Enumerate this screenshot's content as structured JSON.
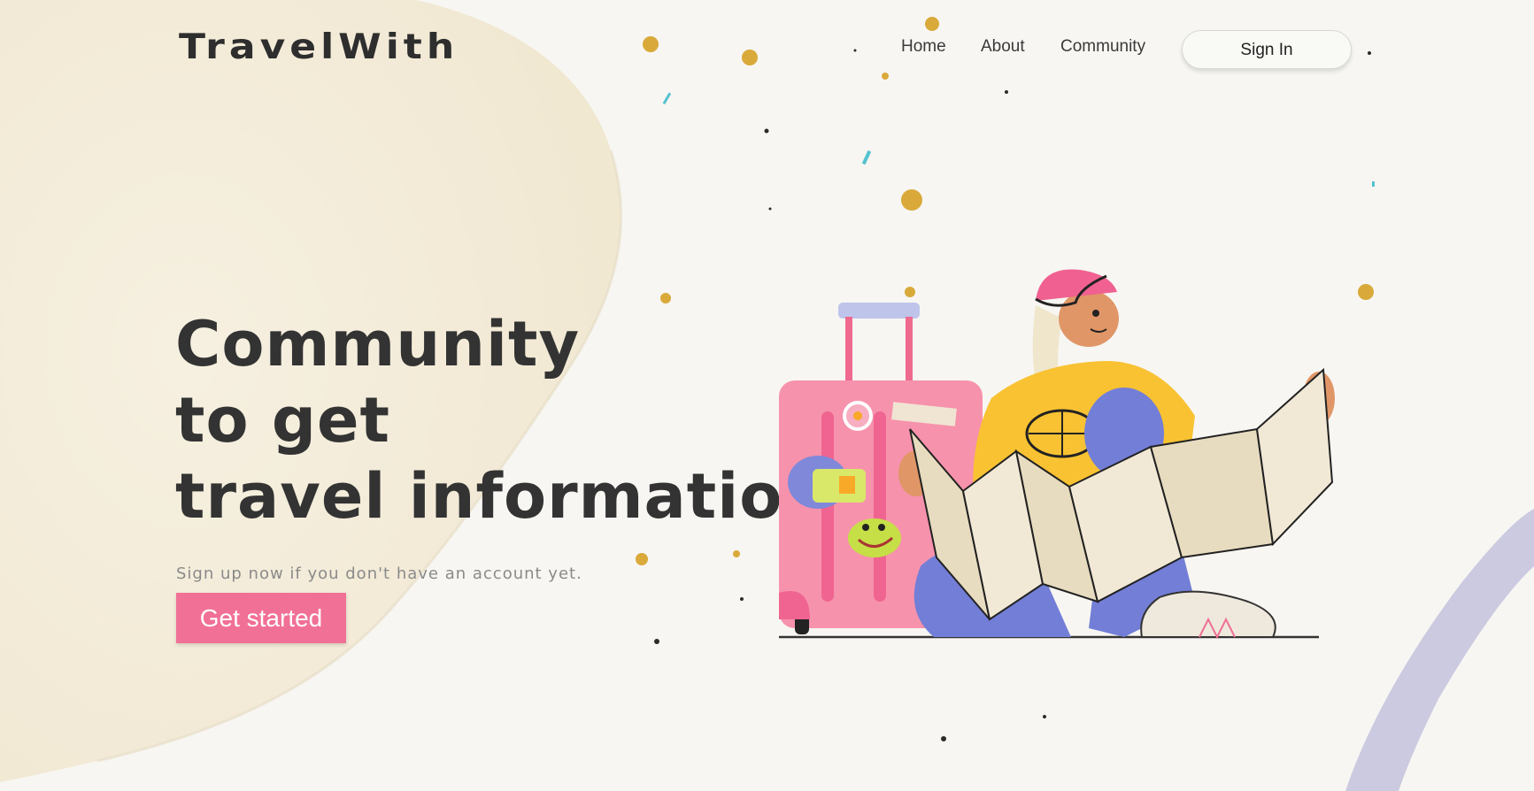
{
  "brand": {
    "logo": "TravelWith"
  },
  "nav": {
    "home": "Home",
    "about": "About",
    "community": "Community",
    "sign_in": "Sign In"
  },
  "hero": {
    "headline_lines": [
      "Community",
      "to get",
      "travel information"
    ],
    "subtext": "Sign up now if you don't have an account yet.",
    "cta": "Get started"
  },
  "colors": {
    "accent_pink": "#f07096",
    "blob_cream": "#f5eedd",
    "text_dark": "#333333",
    "background": "#f7f6f3"
  }
}
